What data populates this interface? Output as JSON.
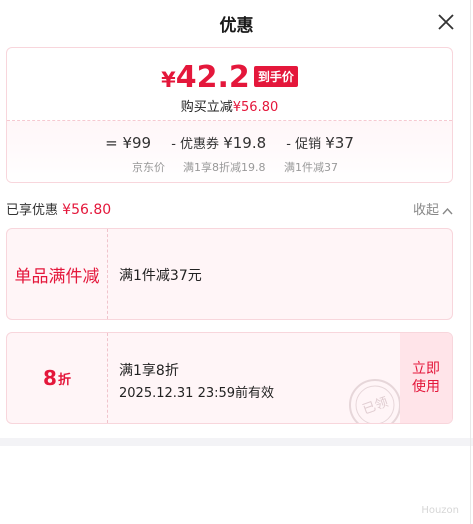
{
  "header": {
    "title": "优惠"
  },
  "price": {
    "currency": "¥",
    "value": "42.2",
    "tag": "到手价",
    "sub_prefix": "购买立减",
    "sub_amount": "¥56.80"
  },
  "formula": {
    "part1": "= ¥99",
    "part2_label": "- 优惠券",
    "part2_value": "¥19.8",
    "part3_label": "- 促销",
    "part3_value": "¥37",
    "labels": [
      "京东价",
      "满1享8折减19.8",
      "满1件减37"
    ]
  },
  "enjoy": {
    "label": "已享优惠",
    "amount": "¥56.80",
    "collapse": "收起"
  },
  "coupons": [
    {
      "left": "单品满件减",
      "desc": "满1件减37元"
    },
    {
      "left_num": "8",
      "left_unit": "折",
      "desc": "满1享8折",
      "date": "2025.12.31 23:59前有效",
      "stamp": "已领",
      "button": "立即使用"
    }
  ],
  "watermark": "Houzon",
  "colors": {
    "accent": "#e4173b",
    "coupon_bg": "#fff5f7",
    "button_bg": "#ffe4e9"
  }
}
